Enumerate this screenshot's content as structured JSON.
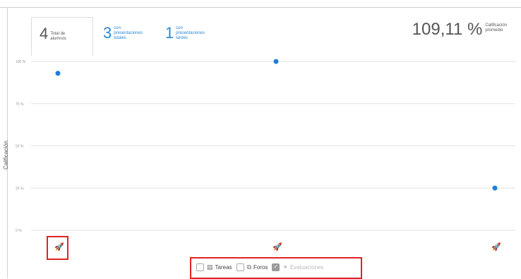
{
  "summary": {
    "total": {
      "value": "4",
      "label_line1": "Total de",
      "label_line2": "alumnos"
    },
    "with_on_time": {
      "value": "3",
      "label_line1": "con",
      "label_line2": "presentaciones",
      "label_line3": "totales"
    },
    "with_late": {
      "value": "1",
      "label_line1": "con",
      "label_line2": "presentaciones",
      "label_line3": "tardes"
    },
    "average": {
      "value": "109,11 %",
      "label_line1": "Calificación",
      "label_line2": "promedio"
    }
  },
  "legend": {
    "items": [
      {
        "label": "Tareas",
        "checked": false,
        "icon": "assignment-icon"
      },
      {
        "label": "Foros",
        "checked": false,
        "icon": "forum-icon"
      },
      {
        "label": "Evaluaciones",
        "checked": true,
        "icon": "assessment-icon"
      }
    ]
  },
  "chart_data": {
    "type": "scatter",
    "ylabel": "Calificación",
    "ylim": [
      0,
      100
    ],
    "yticks": [
      "0 %",
      "25 %",
      "50 %",
      "75 %",
      "100 %"
    ],
    "x_icons": [
      "rocket-icon",
      "rocket-icon",
      "rocket-icon"
    ],
    "points": [
      {
        "x": 1,
        "y": 93
      },
      {
        "x": 2,
        "y": 100
      },
      {
        "x": 3,
        "y": 25
      }
    ],
    "point_color": "#1f7fd6",
    "grid": true
  }
}
